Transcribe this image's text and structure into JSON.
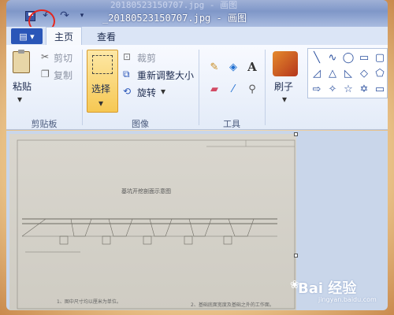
{
  "window": {
    "title": "_20180523150707.jpg - 画图",
    "title_ghost": "20180523150707.jpg - 画图"
  },
  "quick_access": {
    "save_icon": "save-icon",
    "undo_icon": "undo-icon",
    "redo_icon": "redo-icon",
    "highlight_color": "#e5271f"
  },
  "tabs": {
    "file_icon": "menu-icon",
    "items": [
      {
        "label": "主页",
        "active": true
      },
      {
        "label": "查看",
        "active": false
      }
    ]
  },
  "ribbon": {
    "clipboard": {
      "paste": "粘贴",
      "cut": "剪切",
      "copy": "复制",
      "group": "剪贴板"
    },
    "image": {
      "select": "选择",
      "crop": "裁剪",
      "resize": "重新调整大小",
      "rotate": "旋转",
      "group": "图像"
    },
    "tools": {
      "group": "工具",
      "text_glyph": "A"
    },
    "brushes": {
      "label": "刷子"
    }
  },
  "canvas": {
    "drawing_title": "基坑开挖剖面示意图",
    "note_1": "1、图中尺寸均以厘米为单位。",
    "note_2": "2、基础底面宽度及基础之外的工作面。"
  },
  "watermark": {
    "main": "Bai 经验",
    "sub": "jingyan.baidu.com"
  },
  "colors": {
    "accent": "#2a56b8",
    "select_active": "#f6c853"
  }
}
